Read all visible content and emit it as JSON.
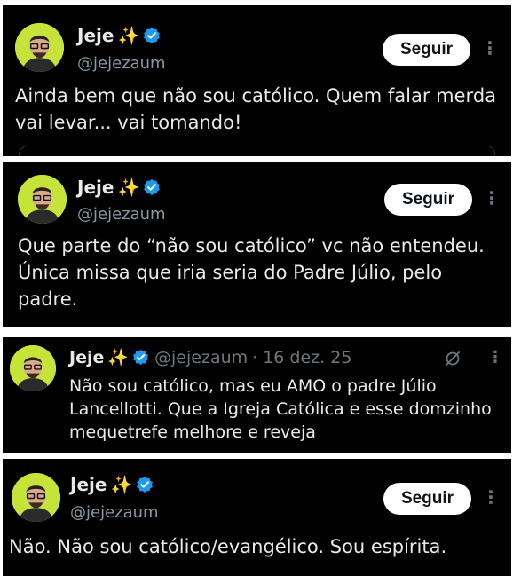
{
  "tweets": [
    {
      "name": "Jeje",
      "sparkle": "✨",
      "handle": "@jejezaum",
      "follow": "Seguir",
      "more": "⋮",
      "text": "Ainda bem que não sou católico. Quem falar merda vai levar... vai tomando!"
    },
    {
      "name": "Jeje",
      "sparkle": "✨",
      "handle": "@jejezaum",
      "follow": "Seguir",
      "more": "⋮",
      "text": "Que parte do “não sou católico” vc não entendeu. Única missa que iria seria do Padre Júlio, pelo padre."
    },
    {
      "name": "Jeje",
      "sparkle": "✨",
      "handle": "@jejezaum",
      "date": "· 16 dez. 25",
      "more": "⋮",
      "text": "Não sou católico, mas eu AMO o padre Júlio Lancellotti. Que a Igreja Católica e esse domzinho mequetrefe melhore e reveja"
    },
    {
      "name": "Jeje",
      "sparkle": "✨",
      "handle": "@jejezaum",
      "follow": "Seguir",
      "more": "⋮",
      "text": "Não. Não sou católico/evangélico. Sou espírita."
    }
  ],
  "colors": {
    "background": "#000000",
    "text": "#e7e9ea",
    "muted": "#8b98a5",
    "verified": "#1d9bf0",
    "avatar": "#c6e33a",
    "button": "#ffffff"
  },
  "icons": [
    "avatar",
    "sparkle-icon",
    "verified-badge-icon",
    "more-icon",
    "grok-icon"
  ]
}
